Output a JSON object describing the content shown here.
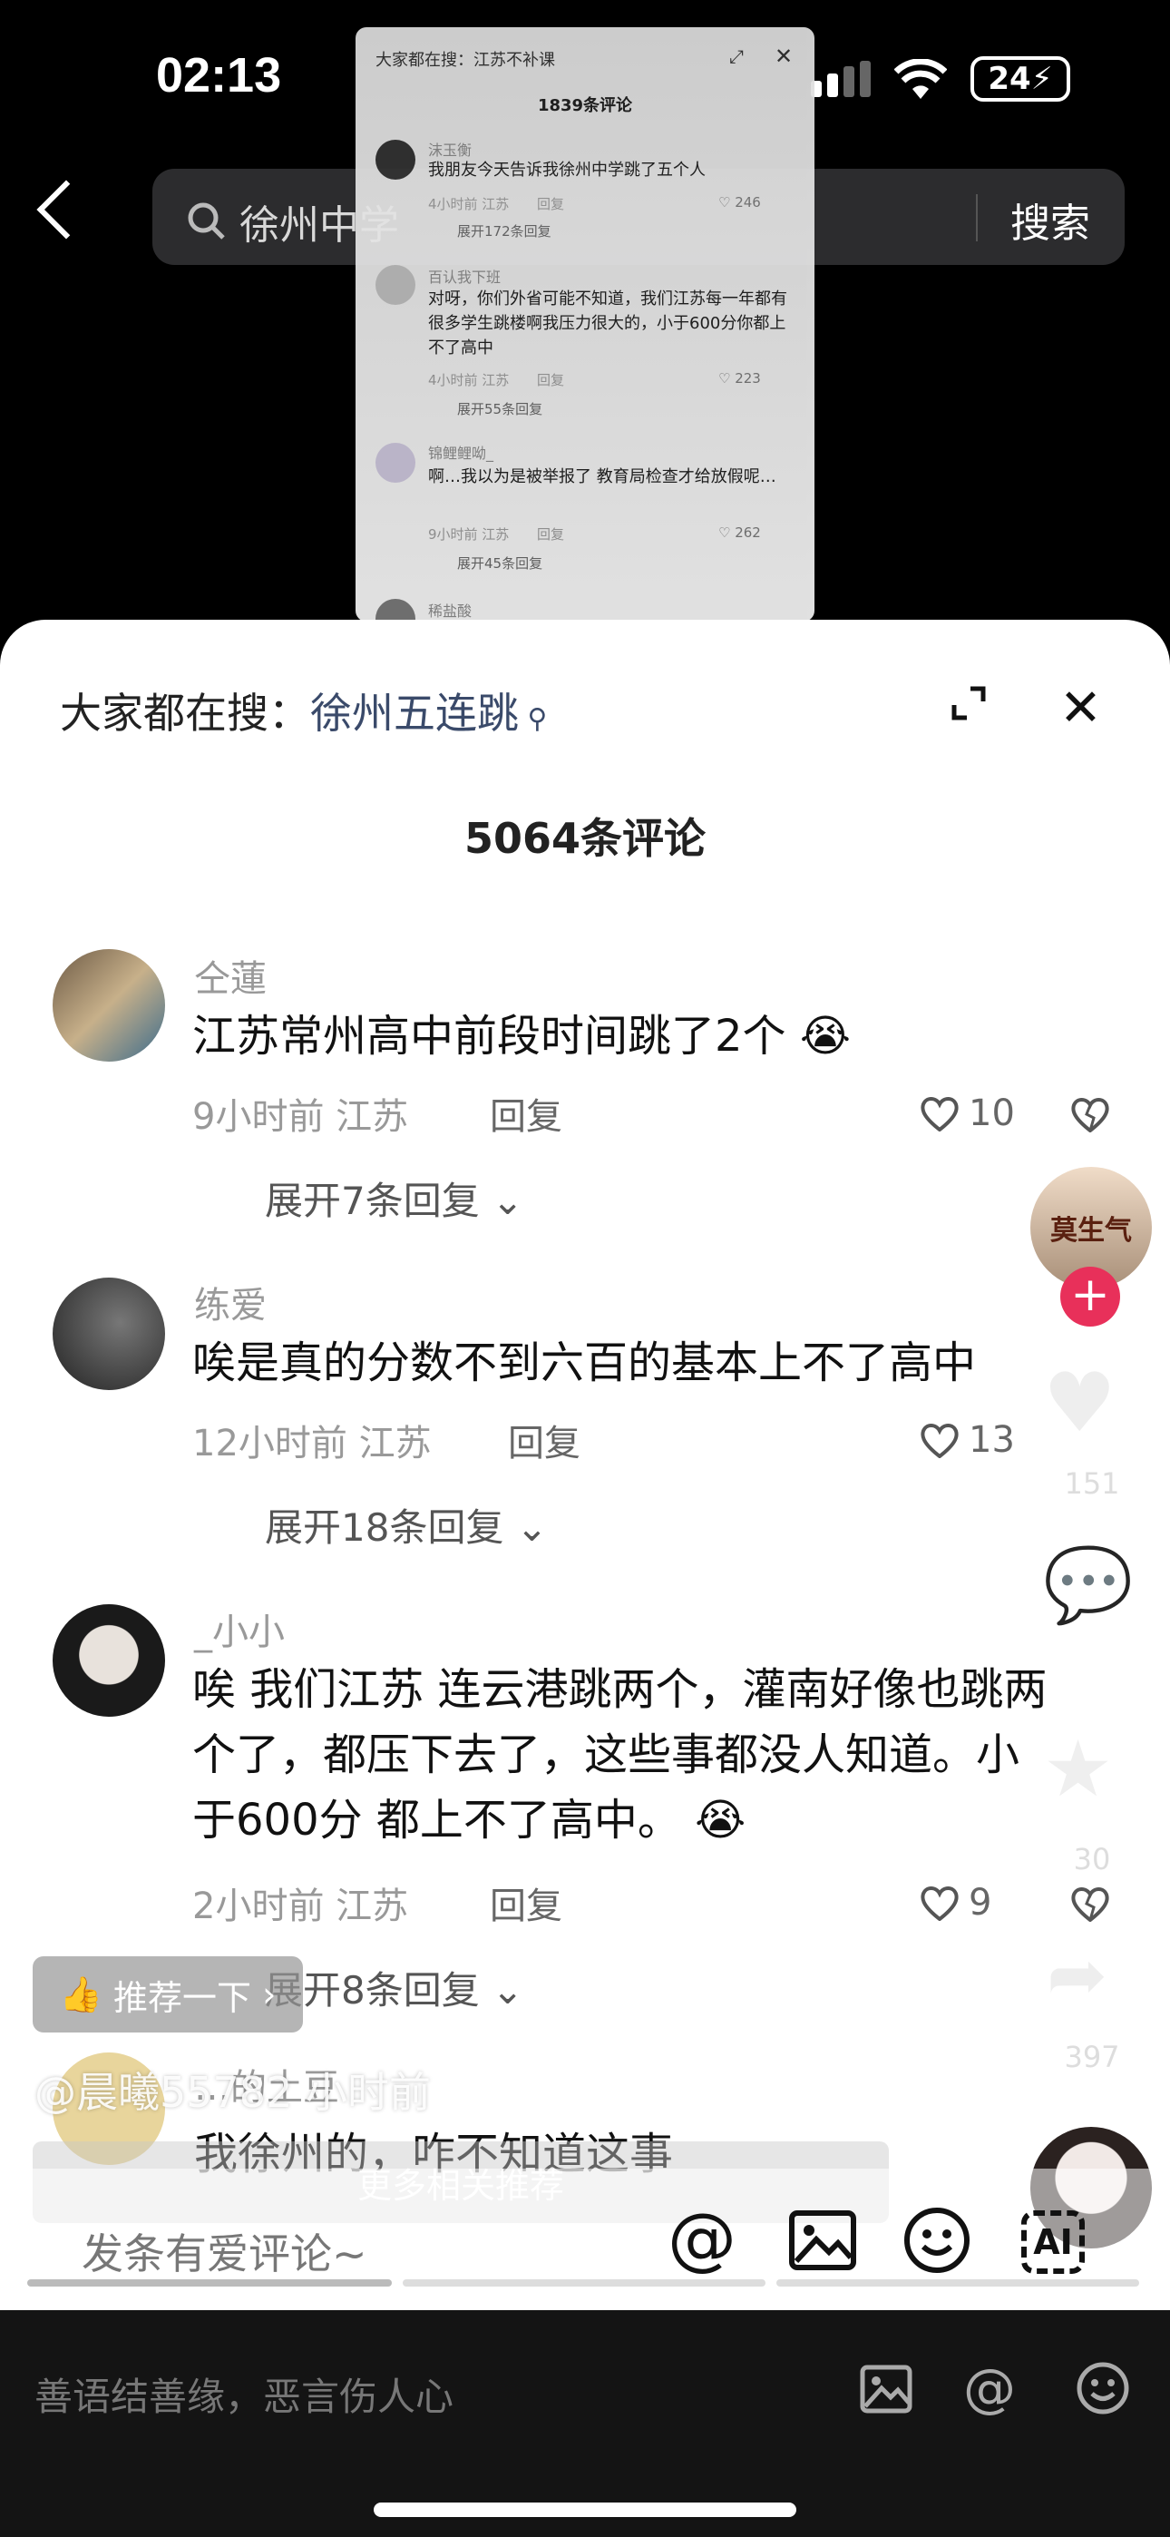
{
  "status": {
    "time": "02:13",
    "battery": "24"
  },
  "search": {
    "query": "徐州中学",
    "button": "搜索"
  },
  "mini": {
    "hot_search": "大家都在搜：江苏不补课",
    "count": "1839条评论",
    "comments": [
      {
        "name": "沫玉衡",
        "text": "我朋友今天告诉我徐州中学跳了五个人",
        "meta": "4小时前 江苏",
        "reply": "回复",
        "likes": "246",
        "expand": "展开172条回复"
      },
      {
        "name": "百认我下班",
        "text": "对呀，你们外省可能不知道，我们江苏每一年都有很多学生跳楼啊我压力很大的，小于600分你都上不了高中",
        "meta": "4小时前 江苏",
        "reply": "回复",
        "likes": "223",
        "expand": "展开55条回复"
      },
      {
        "name": "锦鲤鲤呦_",
        "text": "啊…我以为是被举报了 教育局检查才给放假呢…",
        "meta": "9小时前 江苏",
        "reply": "回复",
        "likes": "262",
        "expand": "展开45条回复"
      }
    ],
    "next_name": "稀盐酸"
  },
  "panel": {
    "hot_label": "大家都在搜：",
    "hot_keyword": "徐州五连跳",
    "count": "5064条评论"
  },
  "comments": [
    {
      "name": "仝蓮",
      "text": "江苏常州高中前段时间跳了2个",
      "time": "9小时前 江苏",
      "reply": "回复",
      "likes": "10",
      "expand": "展开7条回复"
    },
    {
      "name": "练爱",
      "text": "唉是真的分数不到六百的基本上不了高中",
      "time": "12小时前 江苏",
      "reply": "回复",
      "likes": "13",
      "expand": "展开18条回复"
    },
    {
      "name": "_小小",
      "text1": "唉 我们江苏 连云港跳两个，灌南好像也跳两",
      "text2": "个了，都压下去了，这些事都没人知道。小",
      "text3": "于600分 都上不了高中。",
      "time": "2小时前 江苏",
      "reply": "回复",
      "likes": "9",
      "expand": "展开8条回复"
    },
    {
      "name": "…的土豆",
      "text": "我徐州的，咋不知道这事"
    }
  ],
  "side": {
    "likes": "151",
    "stars": "30",
    "shares": "397",
    "avatar_text": "莫生气"
  },
  "overlay": {
    "recommend": "推荐一下",
    "attrib": "@晨曦55782",
    "attrib_time": "小时前",
    "more": "更多相关推荐"
  },
  "compose": {
    "placeholder": "发条有爱评论~"
  },
  "bottom": {
    "placeholder": "善语结善缘，恶言伤人心"
  },
  "colors": {
    "accent": "#e8305a",
    "hot_keyword": "#3a4a6a"
  }
}
